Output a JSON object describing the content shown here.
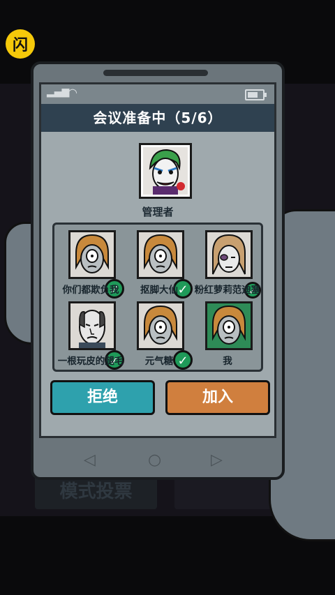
{
  "app": {
    "logo_text": "闪"
  },
  "background": {
    "button_text": "模式投票"
  },
  "dialog": {
    "title": "会议准备中（5/6）",
    "host": {
      "label": "管理者"
    },
    "members": [
      {
        "name": "你们都欺负我",
        "ready": true,
        "avatar": "student-avatar"
      },
      {
        "name": "抠脚大仙",
        "ready": true,
        "avatar": "student-avatar"
      },
      {
        "name": "粉红萝莉范迪塞",
        "ready": true,
        "avatar": "girl-avatar"
      },
      {
        "name": "一根玩皮的腿毛",
        "ready": true,
        "avatar": "old-man-avatar"
      },
      {
        "name": "元气糖",
        "ready": true,
        "avatar": "student-avatar"
      },
      {
        "name": "我",
        "ready": false,
        "avatar": "student-avatar"
      }
    ],
    "reject_label": "拒绝",
    "join_label": "加入"
  },
  "colors": {
    "title_bar": "#2f4150",
    "reject": "#2ea1ad",
    "join": "#d07f3e",
    "check": "#1f9a59",
    "self_bg": "#2e8b57"
  }
}
